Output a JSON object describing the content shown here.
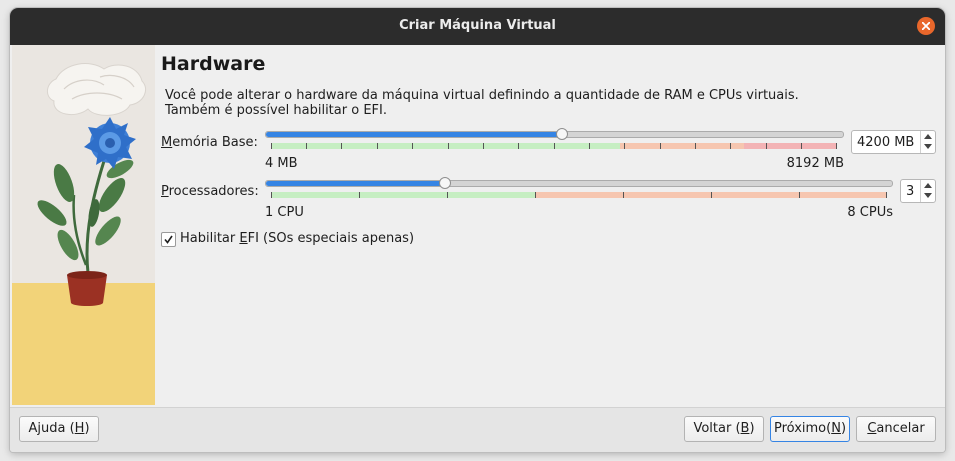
{
  "window": {
    "title": "Criar Máquina Virtual"
  },
  "page": {
    "heading": "Hardware",
    "description_line1": "Você pode alterar o hardware da máquina virtual definindo a quantidade de RAM e CPUs virtuais.",
    "description_line2": "Também é possível habilitar o EFI."
  },
  "memory": {
    "label_prefix": "",
    "label_mnemonic": "M",
    "label_rest": "emória Base:",
    "min_label": "4 MB",
    "max_label": "8192 MB",
    "value": "4200 MB",
    "slider_fraction": 0.5124,
    "colors": {
      "fill": "#3584e4",
      "green": "#c6eec2",
      "orange": "#f6c6b0",
      "red": "#f3b3b5"
    }
  },
  "processors": {
    "label_prefix": "",
    "label_mnemonic": "P",
    "label_rest": "rocessadores:",
    "min_label": "1 CPU",
    "max_label": "8 CPUs",
    "value": "3",
    "slider_fraction": 0.2857
  },
  "efi": {
    "checked": true,
    "label_prefix": "Habilitar ",
    "label_mnemonic": "E",
    "label_rest": "FI (SOs especiais apenas)"
  },
  "buttons": {
    "help": {
      "prefix": "Ajuda (",
      "mnemonic": "H",
      "suffix": ")"
    },
    "back": {
      "prefix": "Voltar (",
      "mnemonic": "B",
      "suffix": ")"
    },
    "next": {
      "prefix": "Próximo(",
      "mnemonic": "N",
      "suffix": ")"
    },
    "cancel": {
      "prefix": "",
      "mnemonic": "C",
      "suffix": "ancelar"
    }
  },
  "icons": {
    "close": "close-icon",
    "check": "checkmark-icon",
    "spin_up": "arrow-up-icon",
    "spin_down": "arrow-down-icon",
    "illustration": "potted-flower-illustration"
  },
  "accent_color": "#3584e4",
  "close_color": "#e9672b"
}
